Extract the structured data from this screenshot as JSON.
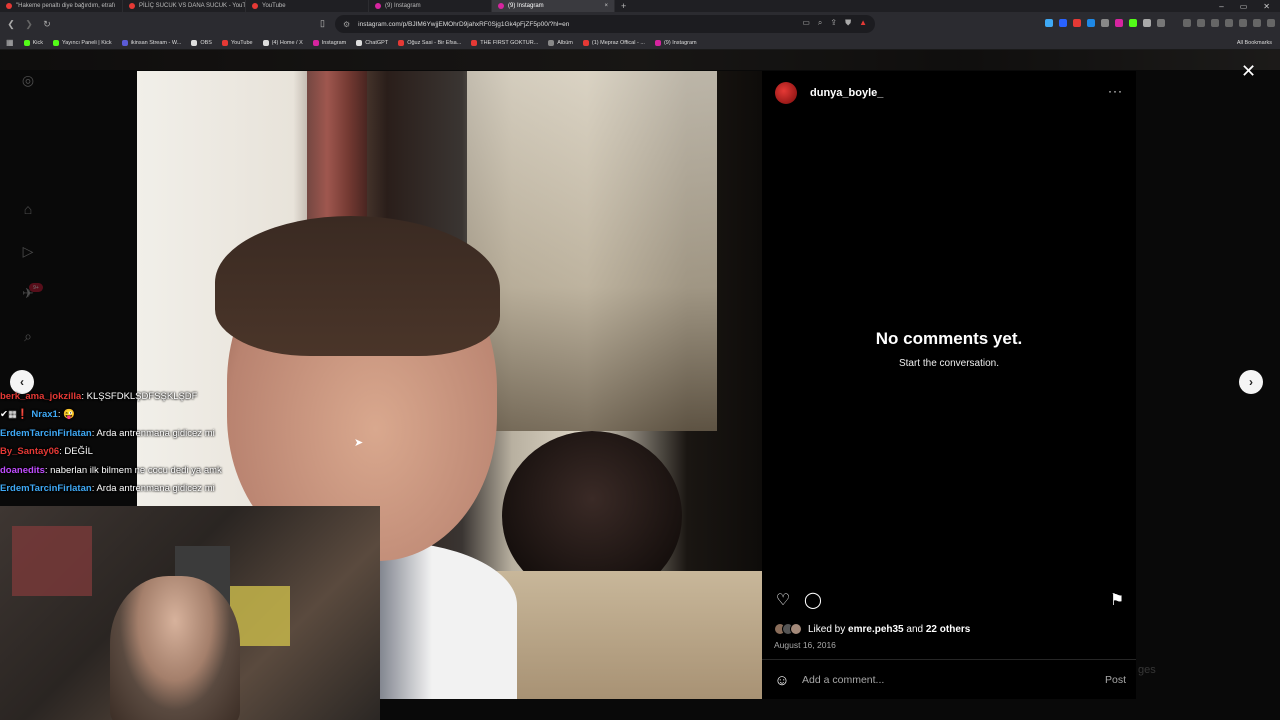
{
  "browser": {
    "tabs": [
      {
        "title": "\"Hakeme penaltı diye bağırdım, etrafı",
        "color": "#e53935",
        "active": false
      },
      {
        "title": "PİLİÇ SUCUK VS DANA SUCUK - YouTube",
        "color": "#e53935",
        "active": false
      },
      {
        "title": "YouTube",
        "color": "#e53935",
        "active": false
      },
      {
        "title": "(9) Instagram",
        "color": "#d6249f",
        "active": false
      },
      {
        "title": "(9) Instagram",
        "color": "#d6249f",
        "active": true
      }
    ],
    "tab_close": "×",
    "new_tab": "+",
    "window_controls": [
      "–",
      "▭",
      "✕"
    ],
    "url": "instagram.com/p/BJIM6YwjjEMOhrD9jahxRF0Sjg1Gk4pFjZF5p00/?hl=en",
    "bookmarks": [
      {
        "label": "Kick",
        "color": "#53fc18"
      },
      {
        "label": "Yayıncı Paneli | Kick",
        "color": "#53fc18"
      },
      {
        "label": "ikinsan Stream - W...",
        "color": "#5b5bd6"
      },
      {
        "label": "OBS",
        "color": "#dddddd"
      },
      {
        "label": "YouTube",
        "color": "#e53935"
      },
      {
        "label": "(4) Home / X",
        "color": "#dddddd"
      },
      {
        "label": "Instagram",
        "color": "#d6249f"
      },
      {
        "label": "ChatGPT",
        "color": "#dddddd"
      },
      {
        "label": "Oğuz Sasi - Bir Efsa...",
        "color": "#e53935"
      },
      {
        "label": "THE FIRST GOKTUR...",
        "color": "#e53935"
      },
      {
        "label": "Albüm",
        "color": "#888888"
      },
      {
        "label": "(1) Mepraz Offical - ...",
        "color": "#e53935"
      },
      {
        "label": "(9) Instagram",
        "color": "#d6249f"
      }
    ],
    "all_bookmarks": "All Bookmarks"
  },
  "sidebar": {
    "badge": "9+"
  },
  "chat": [
    {
      "user": "berk_ama_jokzilla",
      "color": "#e53935",
      "text": ": KLŞSFDKLŞDFSŞKLŞDF"
    },
    {
      "user": "Nrax1",
      "color": "#3fa9f5",
      "prefix": "✔▦❗ ",
      "text": ": 😜"
    },
    {
      "user": "ErdemTarcinFirlatan",
      "color": "#3fa9f5",
      "text": ": Arda antrenmana gidicez mi"
    },
    {
      "user": "By_Santay06",
      "color": "#e53935",
      "text": ": DEĞİL"
    },
    {
      "user": "doanedits",
      "color": "#c04dff",
      "text": ": naberlan ilk bilmem ne cocu dedi ya amk"
    },
    {
      "user": "ErdemTarcinFirlatan",
      "color": "#3fa9f5",
      "text": ": Arda antrenmana gidicez mi"
    }
  ],
  "post": {
    "username": "dunya_boyle_",
    "more_label": "···",
    "empty_title": "No comments yet.",
    "empty_subtitle": "Start the conversation.",
    "liked_by_prefix": "Liked by ",
    "liked_by_user": "emre.peh35",
    "liked_by_mid": " and ",
    "liked_by_others": "22 others",
    "date": "August 16, 2016",
    "comment_placeholder": "Add a comment...",
    "post_label": "Post"
  },
  "background_text": "ges"
}
